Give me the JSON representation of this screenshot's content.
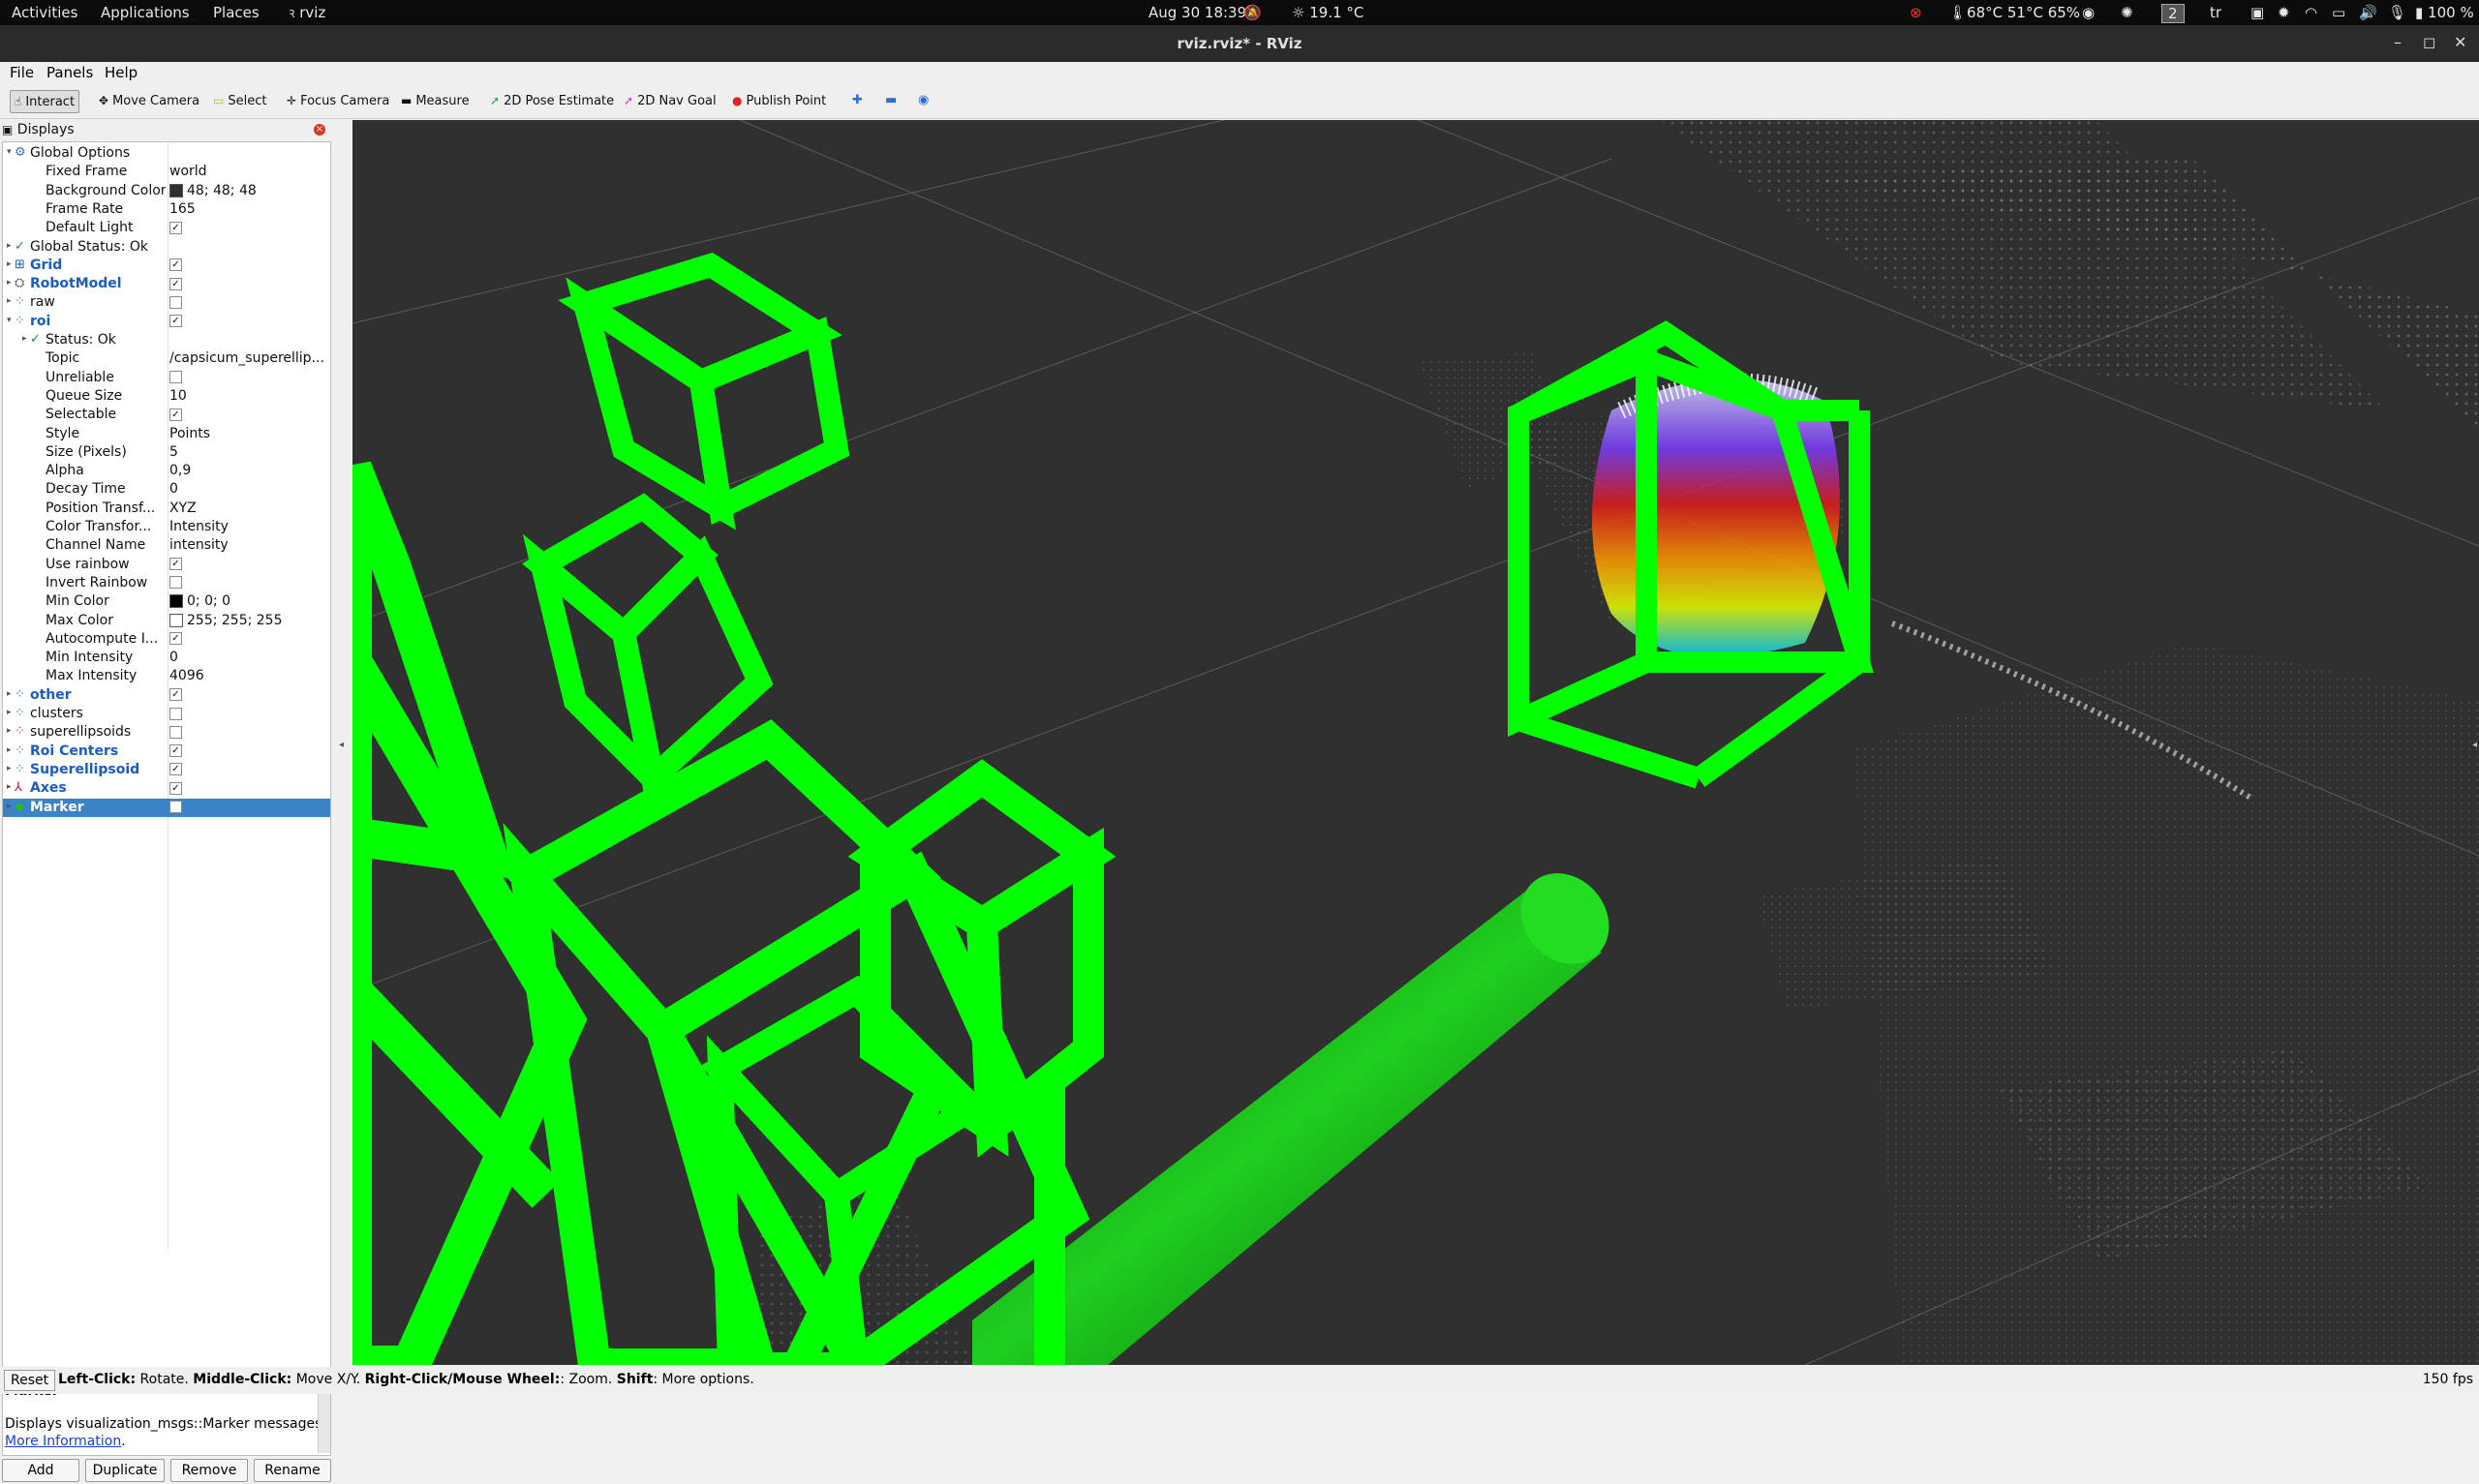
{
  "topbar": {
    "activities": "Activities",
    "applications": "Applications",
    "places": "Places",
    "app_name": "rviz",
    "clock": "Aug 30  18:39",
    "weather": "19.1 °C",
    "sensors": "68°C 51°C 65%",
    "workspace": "2",
    "keyboard": "tr",
    "battery": "100 %"
  },
  "window": {
    "title": "rviz.rviz* - RViz"
  },
  "menu": {
    "file": "File",
    "panels": "Panels",
    "help": "Help"
  },
  "toolbar": {
    "interact": "Interact",
    "move_camera": "Move Camera",
    "select": "Select",
    "focus_camera": "Focus Camera",
    "measure": "Measure",
    "pose_estimate": "2D Pose Estimate",
    "nav_goal": "2D Nav Goal",
    "publish_point": "Publish Point"
  },
  "displays": {
    "header": "Displays",
    "rows": [
      {
        "name": "Global Options",
        "value": "",
        "level": 0,
        "expanded": true,
        "icon": "gear-icon",
        "bold": false
      },
      {
        "name": "Fixed Frame",
        "value": "world",
        "level": 1
      },
      {
        "name": "Background Color",
        "value": "48; 48; 48",
        "level": 1,
        "swatch": "#303030"
      },
      {
        "name": "Frame Rate",
        "value": "165",
        "level": 1
      },
      {
        "name": "Default Light",
        "value": "",
        "level": 1,
        "check": true
      },
      {
        "name": "Global Status: Ok",
        "value": "",
        "level": 0,
        "collapsed": true,
        "icon": "ok-check-icon"
      },
      {
        "name": "Grid",
        "value": "",
        "level": 0,
        "collapsed": true,
        "icon": "grid-icon",
        "bold": true,
        "check": true
      },
      {
        "name": "RobotModel",
        "value": "",
        "level": 0,
        "collapsed": true,
        "icon": "robot-icon",
        "bold": true,
        "check": true
      },
      {
        "name": "raw",
        "value": "",
        "level": 0,
        "collapsed": true,
        "icon": "pointcloud-icon",
        "check": false
      },
      {
        "name": "roi",
        "value": "",
        "level": 0,
        "expanded": true,
        "icon": "pointcloud-icon",
        "bold": true,
        "check": true
      },
      {
        "name": "Status: Ok",
        "value": "",
        "level": 1,
        "collapsed": true,
        "icon": "ok-check-icon"
      },
      {
        "name": "Topic",
        "value": "/capsicum_superellip...",
        "level": 1
      },
      {
        "name": "Unreliable",
        "value": "",
        "level": 1,
        "check": false
      },
      {
        "name": "Queue Size",
        "value": "10",
        "level": 1
      },
      {
        "name": "Selectable",
        "value": "",
        "level": 1,
        "check": true
      },
      {
        "name": "Style",
        "value": "Points",
        "level": 1
      },
      {
        "name": "Size (Pixels)",
        "value": "5",
        "level": 1
      },
      {
        "name": "Alpha",
        "value": "0,9",
        "level": 1
      },
      {
        "name": "Decay Time",
        "value": "0",
        "level": 1
      },
      {
        "name": "Position Transf...",
        "value": "XYZ",
        "level": 1
      },
      {
        "name": "Color Transfor...",
        "value": "Intensity",
        "level": 1
      },
      {
        "name": "Channel Name",
        "value": "intensity",
        "level": 1
      },
      {
        "name": "Use rainbow",
        "value": "",
        "level": 1,
        "check": true
      },
      {
        "name": "Invert Rainbow",
        "value": "",
        "level": 1,
        "check": false
      },
      {
        "name": "Min Color",
        "value": "0; 0; 0",
        "level": 1,
        "swatch": "#000000"
      },
      {
        "name": "Max Color",
        "value": "255; 255; 255",
        "level": 1,
        "swatch": "#ffffff"
      },
      {
        "name": "Autocompute I...",
        "value": "",
        "level": 1,
        "check": true
      },
      {
        "name": "Min Intensity",
        "value": "0",
        "level": 1
      },
      {
        "name": "Max Intensity",
        "value": "4096",
        "level": 1
      },
      {
        "name": "other",
        "value": "",
        "level": 0,
        "collapsed": true,
        "icon": "pointcloud-icon",
        "bold": true,
        "check": true
      },
      {
        "name": "clusters",
        "value": "",
        "level": 0,
        "collapsed": true,
        "icon": "pointcloud-icon",
        "check": false
      },
      {
        "name": "superellipsoids",
        "value": "",
        "level": 0,
        "collapsed": true,
        "icon": "marker-array-icon",
        "check": false
      },
      {
        "name": "Roi Centers",
        "value": "",
        "level": 0,
        "collapsed": true,
        "icon": "pointcloud-icon",
        "bold": true,
        "check": true
      },
      {
        "name": "Superellipsoid",
        "value": "",
        "level": 0,
        "collapsed": true,
        "icon": "pointcloud-icon",
        "bold": true,
        "check": true
      },
      {
        "name": "Axes",
        "value": "",
        "level": 0,
        "collapsed": true,
        "icon": "axes-icon",
        "bold": true,
        "check": true
      },
      {
        "name": "Marker",
        "value": "",
        "level": 0,
        "collapsed": true,
        "icon": "marker-icon",
        "bold": true,
        "check": true,
        "selected": true
      }
    ]
  },
  "description": {
    "title": "Marker",
    "text": "Displays visualization_msgs::Marker messages.",
    "link": "More Information",
    "link_suffix": "."
  },
  "buttons": {
    "add": "Add",
    "duplicate": "Duplicate",
    "remove": "Remove",
    "rename": "Rename"
  },
  "status": {
    "reset": "Reset",
    "hint_html": "<b>Left-Click:</b> Rotate. <b>Middle-Click:</b> Move X/Y. <b>Right-Click/Mouse Wheel:</b>: Zoom. <b>Shift</b>: More options.",
    "fps": "150 fps"
  },
  "colors": {
    "marker_green": "#00ff00",
    "background": "#303030",
    "selection": "#3c82c6"
  }
}
